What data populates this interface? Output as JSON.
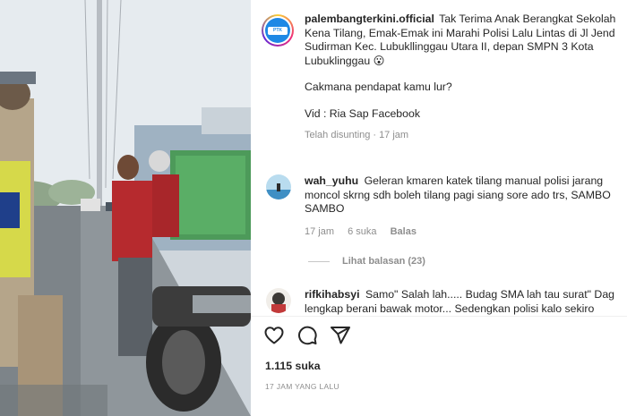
{
  "post": {
    "username": "palembangterkini.official",
    "caption_paragraph_1": "Tak Terima Anak Berangkat Sekolah Kena Tilang, Emak-Emak ini Marahi Polisi Lalu Lintas di Jl Jend Sudirman Kec. Lubukllinggau Utara II, depan SMPN 3 Kota Lubuklinggau 😮",
    "caption_paragraph_2": "Cakmana pendapat kamu lur?",
    "caption_paragraph_3": "Vid : Ria Sap Facebook",
    "edited_label": "Telah disunting",
    "separator": "·",
    "edited_time": "17 jam"
  },
  "comments": [
    {
      "username": "wah_yuhu",
      "text": "Geleran kmaren katek tilang manual polisi jarang moncol skrng sdh boleh tilang pagi siang sore ado trs, SAMBO SAMBO",
      "time": "17 jam",
      "likes": "6 suka",
      "reply_label": "Balas"
    },
    {
      "username": "rifkihabsyi",
      "text": "Samo\" Salah lah..... Budag SMA lah tau surat\" Dag lengkap berani bawak motor... Sedengkan polisi kalo sekiro"
    }
  ],
  "view_replies_label": "Lihat balasan (23)",
  "actions": {
    "like_icon": "heart-icon",
    "comment_icon": "comment-icon",
    "share_icon": "share-icon"
  },
  "likes_count": "1.115 suka",
  "posted_ago": "17 JAM YANG LALU",
  "colors": {
    "text": "#262626",
    "muted": "#8e8e8e",
    "divider": "#efefef"
  }
}
